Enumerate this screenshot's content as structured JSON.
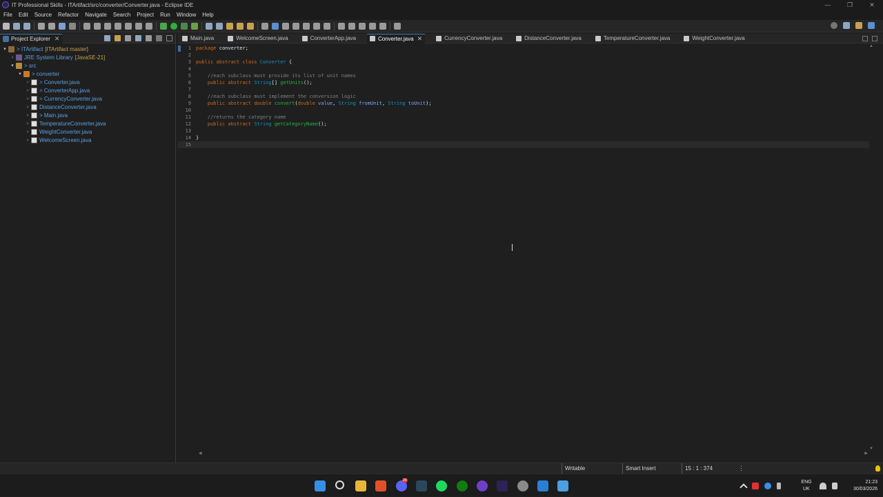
{
  "window": {
    "title": "IT Professional Skills - ITArtifact/src/converter/Converter.java - Eclipse IDE",
    "controls": [
      "—",
      "❐",
      "✕"
    ]
  },
  "menu": [
    "File",
    "Edit",
    "Source",
    "Refactor",
    "Navigate",
    "Search",
    "Project",
    "Run",
    "Window",
    "Help"
  ],
  "explorer": {
    "tab_label": "Project Explorer",
    "close": "✕",
    "tree": [
      {
        "label": "> ITArtifact",
        "suffix": "[ITArtifact master]",
        "kind": "proj",
        "depth": 0,
        "arrow": "▾"
      },
      {
        "label": "JRE System Library",
        "suffix": "[JavaSE-21]",
        "kind": "lib",
        "depth": 1,
        "arrow": "›"
      },
      {
        "label": "> src",
        "suffix": "",
        "kind": "src",
        "depth": 1,
        "arrow": "▾"
      },
      {
        "label": "> converter",
        "suffix": "",
        "kind": "pkg",
        "depth": 2,
        "arrow": "▾"
      },
      {
        "label": "> Converter.java",
        "suffix": "",
        "kind": "file",
        "depth": 3,
        "arrow": "›"
      },
      {
        "label": "> ConverterApp.java",
        "suffix": "",
        "kind": "file",
        "depth": 3,
        "arrow": "›"
      },
      {
        "label": "> CurrencyConverter.java",
        "suffix": "",
        "kind": "file",
        "depth": 3,
        "arrow": "›"
      },
      {
        "label": "DistanceConverter.java",
        "suffix": "",
        "kind": "file",
        "depth": 3,
        "arrow": "›"
      },
      {
        "label": "> Main.java",
        "suffix": "",
        "kind": "file",
        "depth": 3,
        "arrow": "›"
      },
      {
        "label": "TemperatureConverter.java",
        "suffix": "",
        "kind": "file",
        "depth": 3,
        "arrow": "›"
      },
      {
        "label": "WeightConverter.java",
        "suffix": "",
        "kind": "file",
        "depth": 3,
        "arrow": "›"
      },
      {
        "label": "WelcomeScreen.java",
        "suffix": "",
        "kind": "file",
        "depth": 3,
        "arrow": "›"
      }
    ]
  },
  "editor": {
    "tabs": [
      {
        "label": "Main.java",
        "active": false
      },
      {
        "label": "WelcomeScreen.java",
        "active": false
      },
      {
        "label": "ConverterApp.java",
        "active": false
      },
      {
        "label": "Converter.java",
        "active": true
      },
      {
        "label": "CurrencyConverter.java",
        "active": false
      },
      {
        "label": "DistanceConverter.java",
        "active": false
      },
      {
        "label": "TemperatureConverter.java",
        "active": false
      },
      {
        "label": "WeightConverter.java",
        "active": false
      }
    ],
    "current_line": 15,
    "lines": [
      [
        [
          "kw",
          "package"
        ],
        [
          "pl",
          " converter;"
        ]
      ],
      [],
      [
        [
          "kw",
          "public"
        ],
        [
          "pl",
          " "
        ],
        [
          "kw",
          "abstract"
        ],
        [
          "pl",
          " "
        ],
        [
          "kw",
          "class"
        ],
        [
          "pl",
          " "
        ],
        [
          "cls",
          "Converter"
        ],
        [
          "pl",
          " {"
        ]
      ],
      [],
      [
        [
          "pl",
          "    "
        ],
        [
          "cm",
          "//each subclass must provide its list of unit names"
        ]
      ],
      [
        [
          "pl",
          "    "
        ],
        [
          "kw",
          "public"
        ],
        [
          "pl",
          " "
        ],
        [
          "kw",
          "abstract"
        ],
        [
          "pl",
          " "
        ],
        [
          "ty",
          "String"
        ],
        [
          "pl",
          "[] "
        ],
        [
          "me",
          "getUnits"
        ],
        [
          "pl",
          "();"
        ]
      ],
      [],
      [
        [
          "pl",
          "    "
        ],
        [
          "cm",
          "//each subclass must implement the conversion logic"
        ]
      ],
      [
        [
          "pl",
          "    "
        ],
        [
          "kw",
          "public"
        ],
        [
          "pl",
          " "
        ],
        [
          "kw",
          "abstract"
        ],
        [
          "pl",
          " "
        ],
        [
          "kw",
          "double"
        ],
        [
          "pl",
          " "
        ],
        [
          "me",
          "convert"
        ],
        [
          "pl",
          "("
        ],
        [
          "kw",
          "double"
        ],
        [
          "pl",
          " "
        ],
        [
          "pa",
          "value"
        ],
        [
          "pl",
          ", "
        ],
        [
          "ty",
          "String"
        ],
        [
          "pl",
          " "
        ],
        [
          "pa",
          "fromUnit"
        ],
        [
          "pl",
          ", "
        ],
        [
          "ty",
          "String"
        ],
        [
          "pl",
          " "
        ],
        [
          "pa",
          "toUnit"
        ],
        [
          "pl",
          ");"
        ]
      ],
      [],
      [
        [
          "pl",
          "    "
        ],
        [
          "cm",
          "//returns the category name"
        ]
      ],
      [
        [
          "pl",
          "    "
        ],
        [
          "kw",
          "public"
        ],
        [
          "pl",
          " "
        ],
        [
          "kw",
          "abstract"
        ],
        [
          "pl",
          " "
        ],
        [
          "ty",
          "String"
        ],
        [
          "pl",
          " "
        ],
        [
          "me",
          "getCategoryName"
        ],
        [
          "pl",
          "();"
        ]
      ],
      [],
      [
        [
          "pl",
          "}"
        ]
      ],
      []
    ]
  },
  "status": {
    "writable": "Writable",
    "insert_mode": "Smart Insert",
    "position": "15 : 1 : 374",
    "menu": "⋮"
  },
  "taskbar": {
    "lang_top": "ENG",
    "lang_bottom": "UK",
    "time": "21:23",
    "date": "30/03/2026",
    "discord_badge": "29"
  }
}
